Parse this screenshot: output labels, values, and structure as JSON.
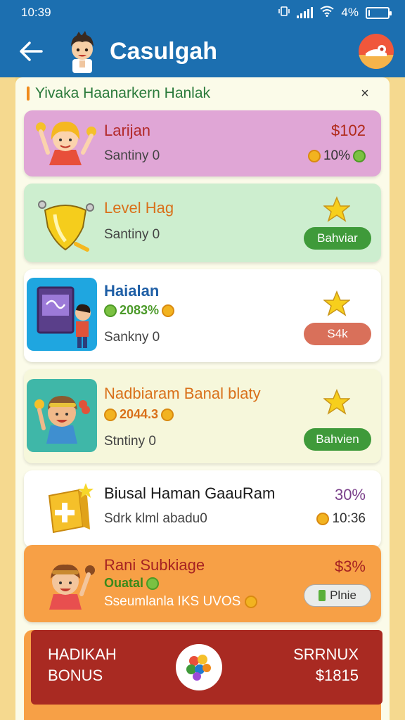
{
  "status": {
    "time": "10:39",
    "battery": "4%",
    "battery_level": 0.04,
    "signal_icon": "signal-icon",
    "wifi_icon": "wifi-icon",
    "vibrate_icon": "vibrate-icon"
  },
  "appbar": {
    "title": "Casulgah",
    "back_icon": "back-arrow-icon",
    "avatar_icon": "character-avatar-icon",
    "profile_icon": "profile-icon",
    "color": "#1c6fb0"
  },
  "sheet": {
    "title": "Yivaka Haanarkern Hanlak",
    "close_label": "×"
  },
  "cards": [
    {
      "title": "Larijan",
      "subtitle": "Santiny 0",
      "price": "$102",
      "price_sub": "10%",
      "color": "#e0a6d6"
    },
    {
      "title": "Level Hag",
      "subtitle": "Santiny 0",
      "button": "Bahviar",
      "color": "#cdeecf"
    },
    {
      "title": "Haialan",
      "tag": "2083%",
      "subtitle": "Sankny 0",
      "button": "S4k",
      "color": "#ffffff"
    },
    {
      "title": "Nadbiaram Banal blaty",
      "tag": "2044.3",
      "subtitle": "Stntiny 0",
      "button": "Bahvien",
      "color": "#f6f7db"
    },
    {
      "title": "Biusal Haman GaauRam",
      "subtitle": "Sdrk klml abadu0",
      "price": "30%",
      "price_sub": "10:36",
      "color": "#ffffff"
    },
    {
      "title": "Rani Subkiage",
      "tag": "Ouatal",
      "subtitle": "Sseumlanla IKS UVOS",
      "price": "$3%",
      "button": "Plnie",
      "color": "#f7a046"
    }
  ],
  "bonus": {
    "title": "HADIKAH BONUS",
    "right_label": "SRRNUX",
    "amount": "$1815",
    "logo_icon": "app-logo-icon",
    "color": "#a92a22"
  }
}
